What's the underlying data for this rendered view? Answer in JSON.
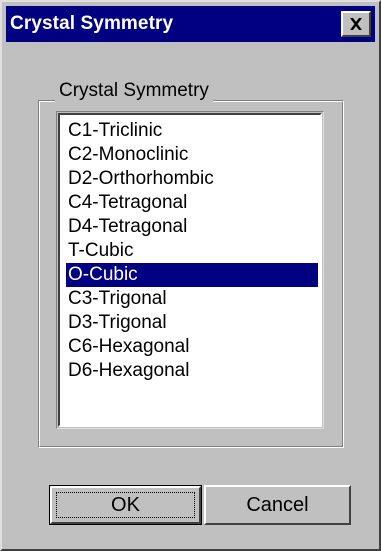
{
  "window": {
    "title": "Crystal Symmetry"
  },
  "group": {
    "legend": "Crystal Symmetry"
  },
  "list": {
    "items": [
      {
        "label": "C1-Triclinic",
        "selected": false
      },
      {
        "label": "C2-Monoclinic",
        "selected": false
      },
      {
        "label": "D2-Orthorhombic",
        "selected": false
      },
      {
        "label": "C4-Tetragonal",
        "selected": false
      },
      {
        "label": "D4-Tetragonal",
        "selected": false
      },
      {
        "label": "T-Cubic",
        "selected": false
      },
      {
        "label": "O-Cubic",
        "selected": true
      },
      {
        "label": "C3-Trigonal",
        "selected": false
      },
      {
        "label": "D3-Trigonal",
        "selected": false
      },
      {
        "label": "C6-Hexagonal",
        "selected": false
      },
      {
        "label": "D6-Hexagonal",
        "selected": false
      }
    ]
  },
  "buttons": {
    "ok_label": "OK",
    "cancel_label": "Cancel"
  },
  "colors": {
    "titlebar": "#000080",
    "selection": "#000080",
    "face": "#c0c0c0"
  },
  "icons": {
    "close": "close-icon"
  }
}
